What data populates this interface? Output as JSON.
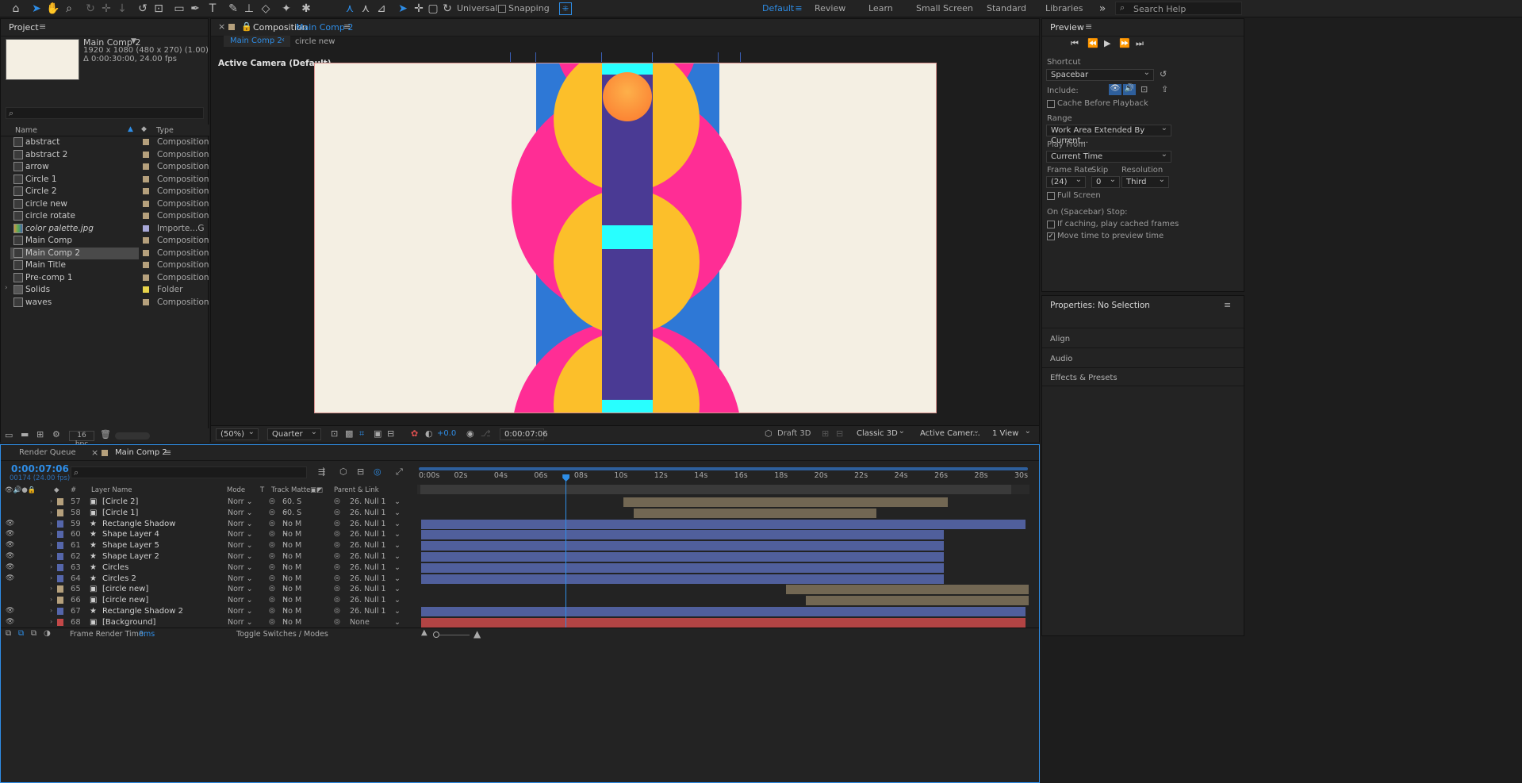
{
  "toolbar": {
    "snap_mode": "Universal",
    "snapping": "Snapping",
    "workspaces": [
      "Default",
      "Review",
      "Learn",
      "Small Screen",
      "Standard",
      "Libraries"
    ],
    "search_placeholder": "Search Help"
  },
  "project": {
    "title": "Project",
    "comp_name": "Main Comp 2",
    "comp_res": "1920 x 1080  (480 x 270) (1.00)",
    "comp_dur": "Δ 0:00:30:00, 24.00 fps",
    "col_name": "Name",
    "col_type": "Type",
    "items": [
      {
        "name": "abstract",
        "type": "Composition"
      },
      {
        "name": "abstract 2",
        "type": "Composition"
      },
      {
        "name": "arrow",
        "type": "Composition"
      },
      {
        "name": "Circle 1",
        "type": "Composition"
      },
      {
        "name": "Circle 2",
        "type": "Composition"
      },
      {
        "name": "circle new",
        "type": "Composition"
      },
      {
        "name": "circle rotate",
        "type": "Composition"
      },
      {
        "name": "color palette.jpg",
        "type": "Importe...G"
      },
      {
        "name": "Main Comp",
        "type": "Composition"
      },
      {
        "name": "Main Comp 2",
        "type": "Composition"
      },
      {
        "name": "Main Title",
        "type": "Composition"
      },
      {
        "name": "Pre-comp 1",
        "type": "Composition"
      },
      {
        "name": "Solids",
        "type": "Folder"
      },
      {
        "name": "waves",
        "type": "Composition"
      }
    ],
    "bpc": "16 bpc"
  },
  "composition": {
    "panel_title": "Composition",
    "panel_comp": "Main Comp 2",
    "tab_active": "Main Comp 2",
    "tab_other": "circle new",
    "camera_label": "Active Camera (Default)",
    "zoom": "(50%)",
    "resolution": "Quarter",
    "exposure": "+0.0",
    "time": "0:00:07:06",
    "draft": "Draft 3D",
    "renderer": "Classic 3D",
    "camera": "Active Camer...",
    "views": "1 View"
  },
  "preview": {
    "title": "Preview",
    "shortcut_label": "Shortcut",
    "shortcut": "Spacebar",
    "include_label": "Include:",
    "cache_before": "Cache Before Playback",
    "range_label": "Range",
    "range": "Work Area Extended By Current...",
    "playfrom_label": "Play From",
    "playfrom": "Current Time",
    "framerate_label": "Frame Rate",
    "skip_label": "Skip",
    "resolution_label": "Resolution",
    "framerate": "(24)",
    "skip": "0",
    "resolution": "Third",
    "fullscreen": "Full Screen",
    "stop_label": "On (Spacebar) Stop:",
    "if_caching": "If caching, play cached frames",
    "move_time": "Move time to preview time"
  },
  "properties": {
    "title": "Properties: No Selection",
    "sections": [
      "Align",
      "Audio",
      "Effects & Presets"
    ]
  },
  "timeline": {
    "tab_render": "Render Queue",
    "tab_comp": "Main Comp 2",
    "timecode": "0:00:07:06",
    "frame": "00174 (24.00 fps)",
    "col_num": "#",
    "col_layer": "Layer Name",
    "col_mode": "Mode",
    "col_t": "T",
    "col_matte": "Track Matte",
    "col_parent": "Parent & Link",
    "ruler": [
      "0:00s",
      "02s",
      "04s",
      "06s",
      "08s",
      "10s",
      "12s",
      "14s",
      "16s",
      "18s",
      "20s",
      "22s",
      "24s",
      "26s",
      "28s",
      "30s"
    ],
    "layers": [
      {
        "num": "57",
        "name": "[Circle 2]",
        "mode": "Norr",
        "matte": "60. S",
        "parent": "26. Null 1",
        "color": "#b5a07c",
        "start": 0.333,
        "end": 0.867
      },
      {
        "num": "58",
        "name": "[Circle 1]",
        "mode": "Norr",
        "matte": "60. S",
        "parent": "26. Null 1",
        "color": "#b5a07c",
        "start": 0.35,
        "end": 0.75
      },
      {
        "num": "59",
        "name": "Rectangle Shadow",
        "mode": "Norr",
        "matte": "No M",
        "parent": "26. Null 1",
        "color": "#5566aa",
        "start": 0.0,
        "end": 0.995
      },
      {
        "num": "60",
        "name": "Shape Layer 4",
        "mode": "Norr",
        "matte": "No M",
        "parent": "26. Null 1",
        "color": "#5566aa",
        "start": 0.0,
        "end": 0.86
      },
      {
        "num": "61",
        "name": "Shape Layer 5",
        "mode": "Norr",
        "matte": "No M",
        "parent": "26. Null 1",
        "color": "#5566aa",
        "start": 0.0,
        "end": 0.86
      },
      {
        "num": "62",
        "name": "Shape Layer 2",
        "mode": "Norr",
        "matte": "No M",
        "parent": "26. Null 1",
        "color": "#5566aa",
        "start": 0.0,
        "end": 0.86
      },
      {
        "num": "63",
        "name": "Circles",
        "mode": "Norr",
        "matte": "No M",
        "parent": "26. Null 1",
        "color": "#5566aa",
        "start": 0.0,
        "end": 0.86
      },
      {
        "num": "64",
        "name": "Circles 2",
        "mode": "Norr",
        "matte": "No M",
        "parent": "26. Null 1",
        "color": "#5566aa",
        "start": 0.0,
        "end": 0.86
      },
      {
        "num": "65",
        "name": "[circle new]",
        "mode": "Norr",
        "matte": "No M",
        "parent": "26. Null 1",
        "color": "#b5a07c",
        "start": 0.6,
        "end": 1.0
      },
      {
        "num": "66",
        "name": "[circle new]",
        "mode": "Norr",
        "matte": "No M",
        "parent": "26. Null 1",
        "color": "#b5a07c",
        "start": 0.633,
        "end": 1.0
      },
      {
        "num": "67",
        "name": "Rectangle Shadow 2",
        "mode": "Norr",
        "matte": "No M",
        "parent": "26. Null 1",
        "color": "#5566aa",
        "start": 0.0,
        "end": 0.995
      },
      {
        "num": "68",
        "name": "[Background]",
        "mode": "Norr",
        "matte": "No M",
        "parent": "None",
        "color": "#c24848",
        "start": 0.0,
        "end": 0.995
      }
    ],
    "playhead": 0.2417,
    "render_time_label": "Frame Render Time:",
    "render_time": "0ms",
    "toggle_label": "Toggle Switches / Modes"
  },
  "colors": {
    "accent": "#2e8de6",
    "canvas_bg": "#f4efe3",
    "pink": "#ff2d95",
    "yellow": "#fcbf2a",
    "blue": "#2e78d6",
    "purple": "#4a3a94",
    "cyan": "#28ffff",
    "orange": "#fc9a3c"
  }
}
